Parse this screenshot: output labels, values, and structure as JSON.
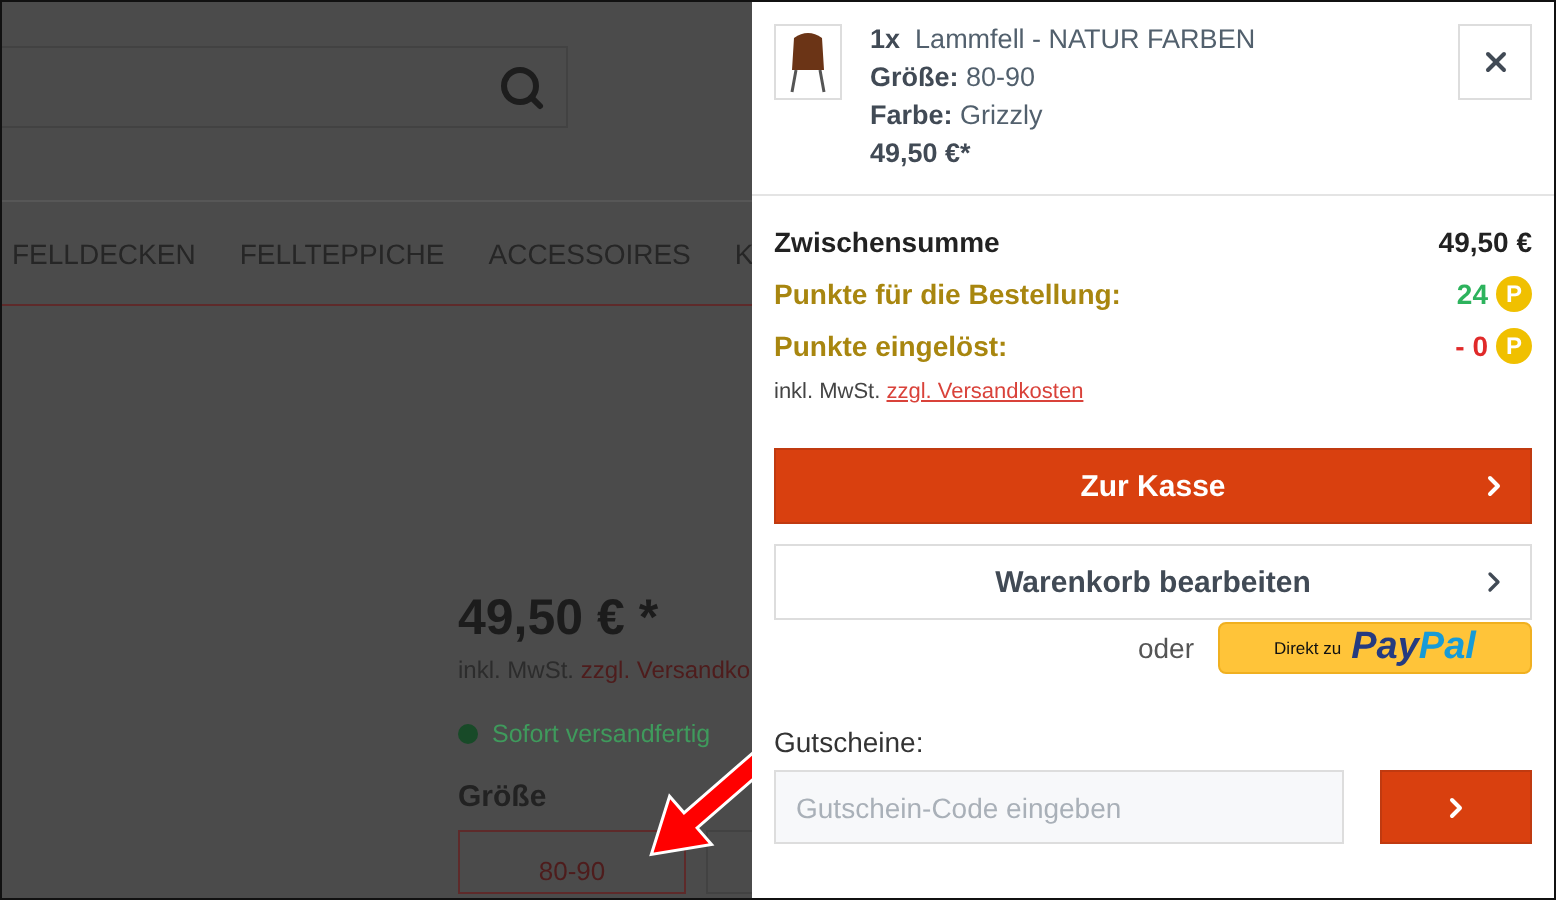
{
  "nav": {
    "items": [
      "FELLDECKEN",
      "FELLTEPPICHE",
      "ACCESSOIRES",
      "K"
    ]
  },
  "product": {
    "price": "49,50 € *",
    "tax_note": "inkl. MwSt.",
    "shipping_link": "zzgl. Versandko",
    "availability": "Sofort versandfertig",
    "size_label": "Größe",
    "size_options": [
      {
        "label": "80-90",
        "selected": true
      },
      {
        "selected": false
      }
    ]
  },
  "cart": {
    "item": {
      "qty": "1x",
      "name": "Lammfell - NATUR FARBEN",
      "attributes": [
        {
          "label": "Größe:",
          "value": "80-90"
        },
        {
          "label": "Farbe:",
          "value": "Grizzly"
        }
      ],
      "price": "49,50 €*"
    },
    "summary": [
      {
        "kind": "total",
        "label": "Zwischensumme",
        "value": "49,50 €"
      },
      {
        "kind": "points_earned",
        "label": "Punkte für die Bestellung:",
        "value": "24",
        "badge": "P"
      },
      {
        "kind": "points_redeemed",
        "label": "Punkte eingelöst:",
        "value": "- 0",
        "badge": "P"
      }
    ],
    "tax_note": "inkl. MwSt.",
    "shipping_link": "zzgl. Versandkosten",
    "checkout_button": "Zur Kasse",
    "edit_cart_button": "Warenkorb bearbeiten",
    "or_label": "oder",
    "paypal": {
      "prefix": "Direkt zu",
      "brand_dark": "Pay",
      "brand_light": "Pal"
    },
    "voucher": {
      "label": "Gutscheine:",
      "placeholder": "Gutschein-Code eingeben"
    }
  }
}
